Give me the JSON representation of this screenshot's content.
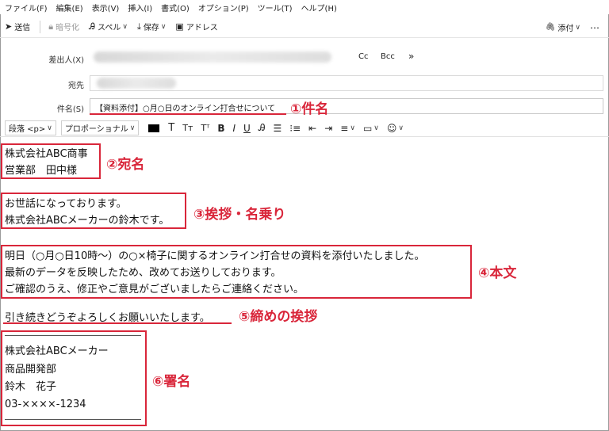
{
  "menu": [
    "ファイル(F)",
    "編集(E)",
    "表示(V)",
    "挿入(I)",
    "書式(O)",
    "オプション(P)",
    "ツール(T)",
    "ヘルプ(H)"
  ],
  "toolbar": {
    "send": "送信",
    "encrypt": "暗号化",
    "spell": "スペル",
    "save": "保存",
    "address": "アドレス",
    "attach": "添付"
  },
  "fields": {
    "from_label": "差出人(X)",
    "to_label": "宛先",
    "subject_label": "件名(S)",
    "subject_value": "【資料添付】○月○日のオンライン打合せについて",
    "cc": "Cc",
    "bcc": "Bcc",
    "more": "»"
  },
  "format": {
    "paragraph": "段落 <p>",
    "font": "プロポーショナル"
  },
  "body": {
    "addressee": [
      "株式会社ABC商事",
      "営業部　田中様"
    ],
    "greeting": [
      "お世話になっております。",
      "株式会社ABCメーカーの鈴木です。"
    ],
    "main": [
      "明日（○月○日10時～）の○×椅子に関するオンライン打合せの資料を添付いたしました。",
      "最新のデータを反映したため、改めてお送りしております。",
      "ご確認のうえ、修正やご意見がございましたらご連絡ください。"
    ],
    "closing": "引き続きどうぞよろしくお願いいたします。",
    "signature": [
      "株式会社ABCメーカー",
      "商品開発部",
      "鈴木　花子",
      "03-××××-1234"
    ]
  },
  "annotations": {
    "subject": "①件名",
    "addressee": "②宛名",
    "greeting": "③挨拶・名乗り",
    "main": "④本文",
    "closing": "⑤締めの挨拶",
    "signature": "⑥署名"
  },
  "colors": {
    "annotation": "#d9263a"
  }
}
